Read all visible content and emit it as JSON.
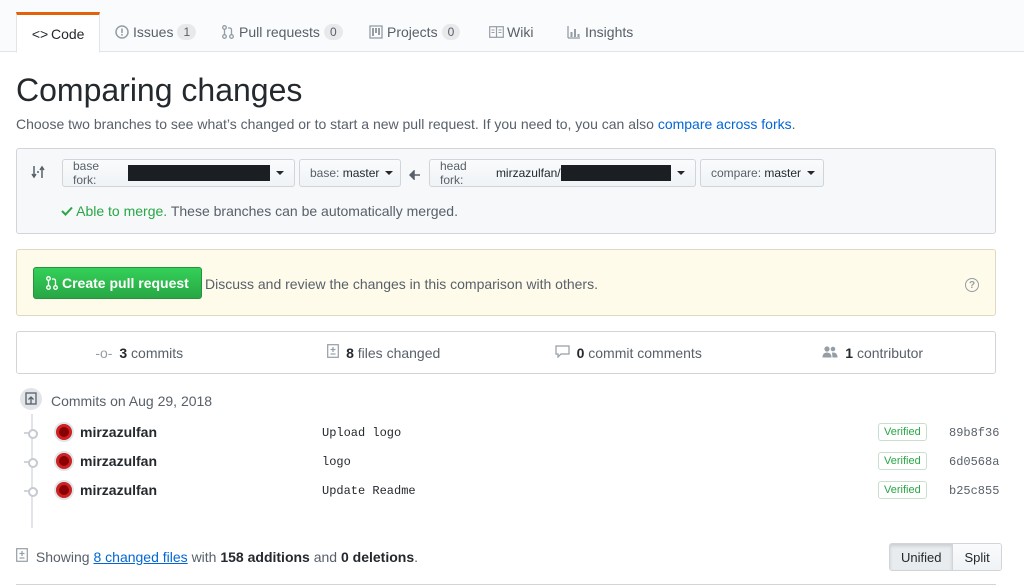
{
  "tabs": [
    {
      "label": "Code",
      "icon": "code-icon",
      "count": null
    },
    {
      "label": "Issues",
      "icon": "issue-icon",
      "count": "1"
    },
    {
      "label": "Pull requests",
      "icon": "pull-request-icon",
      "count": "0"
    },
    {
      "label": "Projects",
      "icon": "project-icon",
      "count": "0"
    },
    {
      "label": "Wiki",
      "icon": "book-icon",
      "count": null
    },
    {
      "label": "Insights",
      "icon": "graph-icon",
      "count": null
    }
  ],
  "page": {
    "title": "Comparing changes",
    "subtitle_text": "Choose two branches to see what’s changed or to start a new pull request. If you need to, you can also",
    "subtitle_link": "compare across forks",
    "subtitle_end": "."
  },
  "range": {
    "base_fork_label": "base fork:",
    "base_label": "base:",
    "base_value": "master",
    "head_fork_label": "head fork:",
    "head_fork_value": "mirzazulfan/",
    "compare_label": "compare:",
    "compare_value": "master",
    "merge_status": "Able to merge.",
    "merge_text": "These branches can be automatically merged."
  },
  "pr": {
    "button_label": "Create pull request",
    "description": "Discuss and review the changes in this comparison with others."
  },
  "stats": {
    "commits_count": "3",
    "commits_label": "commits",
    "files_count": "8",
    "files_label": "files changed",
    "comments_count": "0",
    "comments_label": "commit comments",
    "contributors_count": "1",
    "contributors_label": "contributor"
  },
  "commit_group": {
    "title": "Commits on Aug 29, 2018"
  },
  "commits": [
    {
      "author": "mirzazulfan",
      "message": "Upload logo",
      "badge": "Verified",
      "sha": "89b8f36"
    },
    {
      "author": "mirzazulfan",
      "message": "logo",
      "badge": "Verified",
      "sha": "6d0568a"
    },
    {
      "author": "mirzazulfan",
      "message": "Update Readme",
      "badge": "Verified",
      "sha": "b25c855"
    }
  ],
  "summary": {
    "showing": "Showing",
    "files_link": "8 changed files",
    "with": "with",
    "additions": "158 additions",
    "and": "and",
    "deletions": "0 deletions",
    "end": "."
  },
  "view_toggle": {
    "unified": "Unified",
    "split": "Split"
  },
  "colors": {
    "accent_tab": "#e36209",
    "link": "#0366d6",
    "success": "#28a745"
  }
}
